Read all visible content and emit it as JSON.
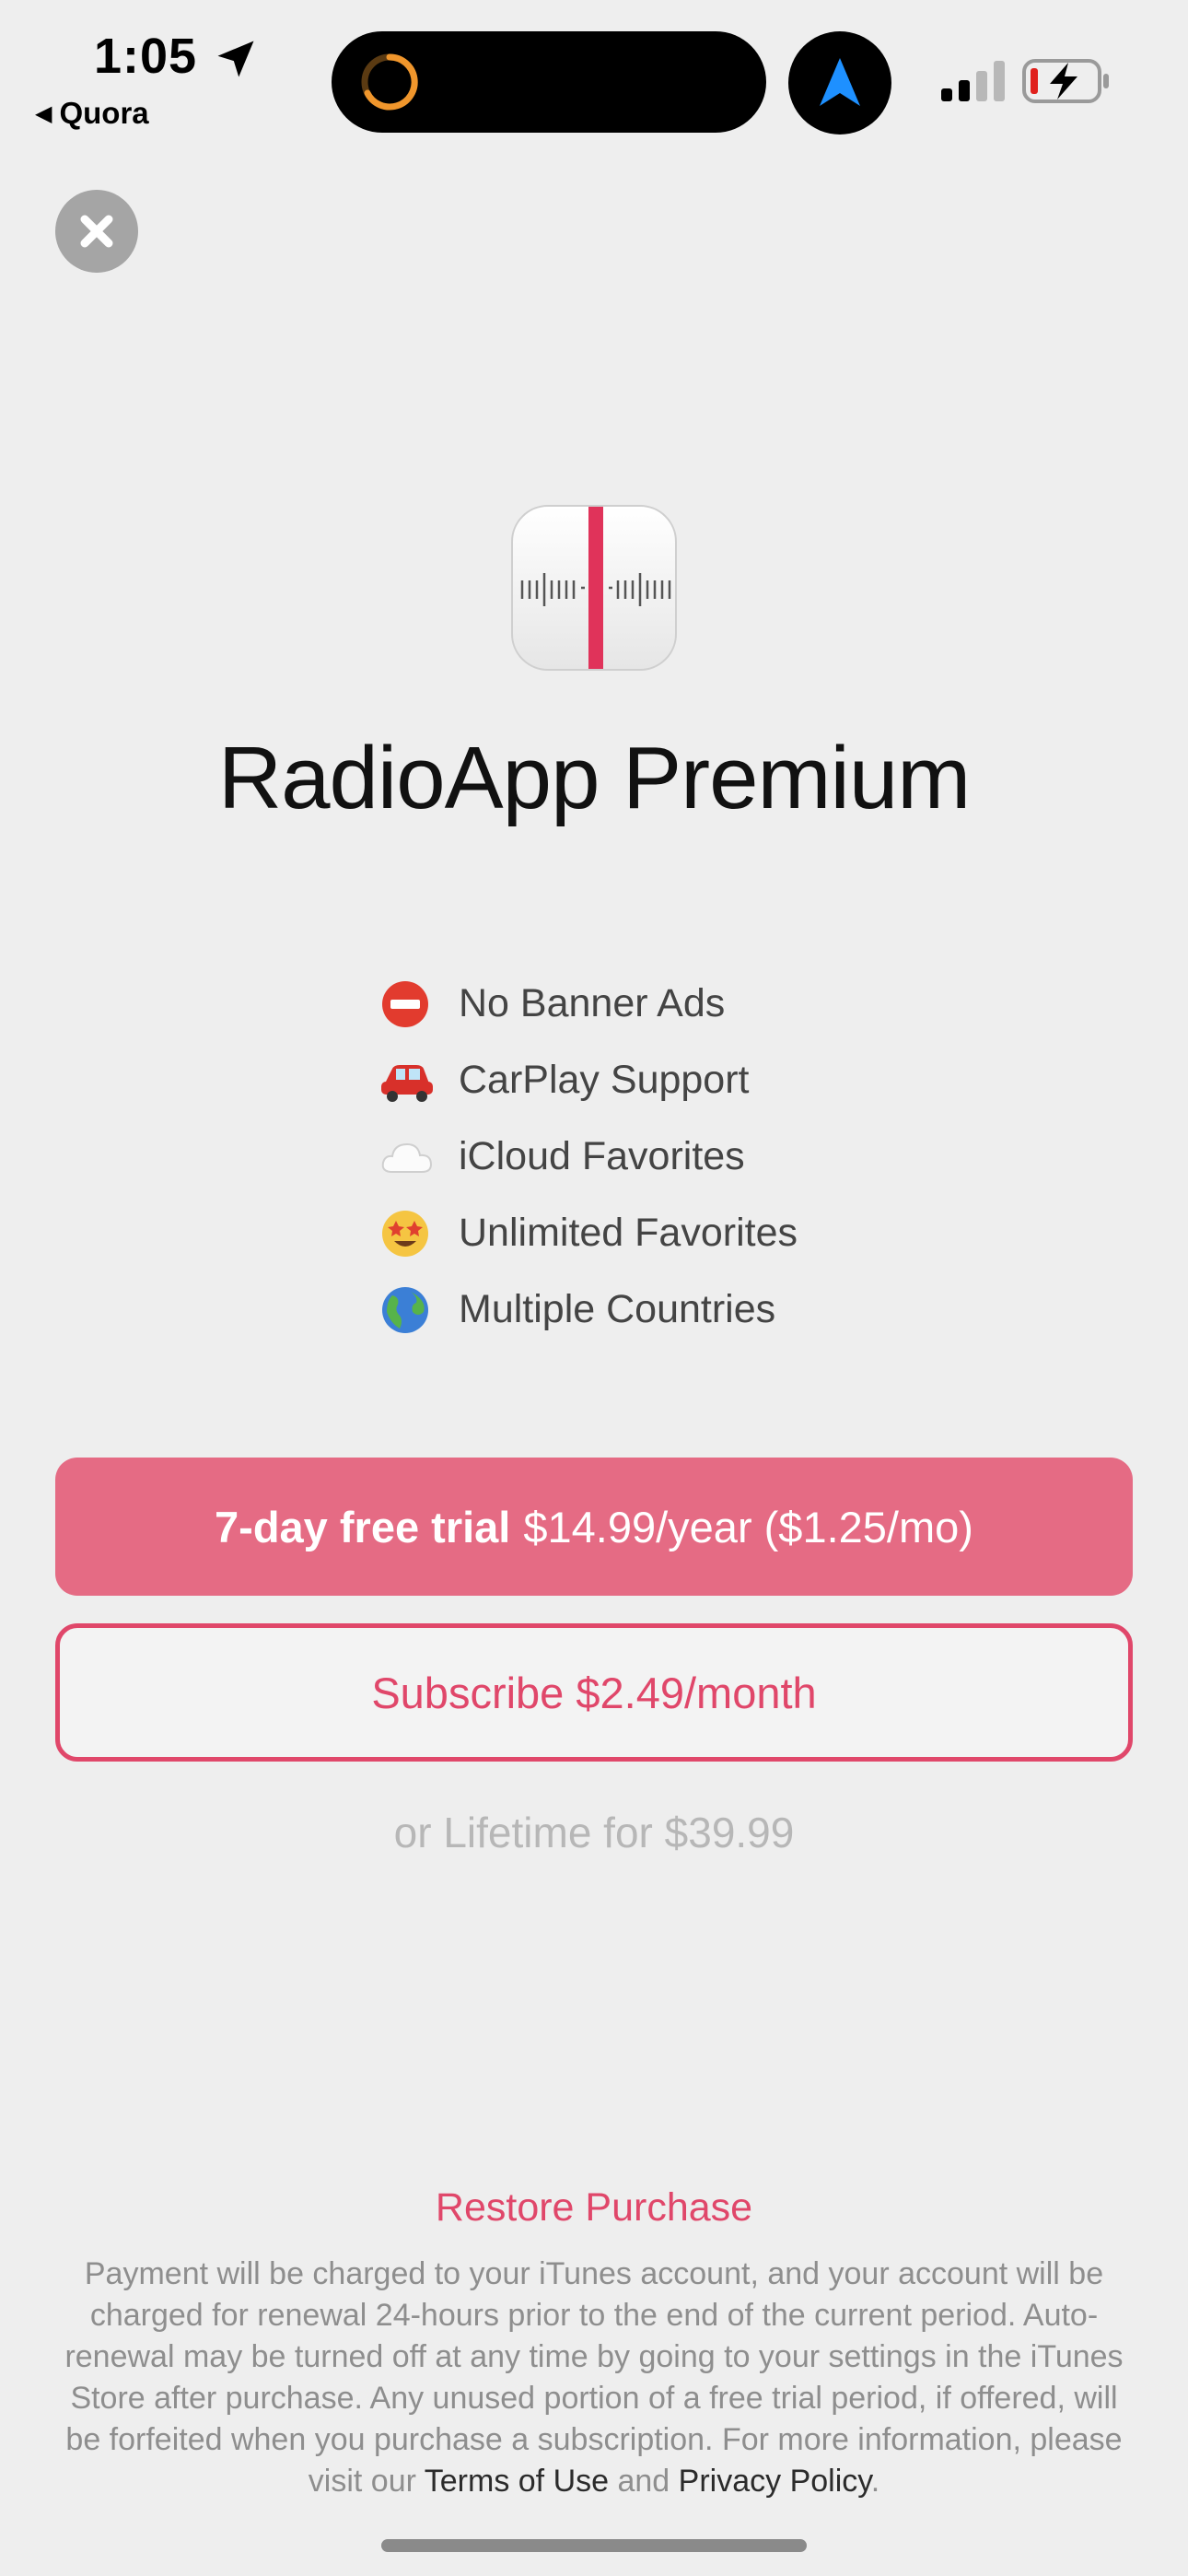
{
  "status_bar": {
    "time": "1:05",
    "back_app": "Quora"
  },
  "app": {
    "title": "RadioApp Premium",
    "accent_color": "#e0476a"
  },
  "features": [
    {
      "icon": "no-entry-icon",
      "label": "No Banner Ads"
    },
    {
      "icon": "car-icon",
      "label": "CarPlay Support"
    },
    {
      "icon": "cloud-icon",
      "label": "iCloud Favorites"
    },
    {
      "icon": "star-struck-icon",
      "label": "Unlimited Favorites"
    },
    {
      "icon": "globe-icon",
      "label": "Multiple Countries"
    }
  ],
  "plans": {
    "trial_bold": "7-day free trial",
    "trial_price": "$14.99/year ($1.25/mo)",
    "monthly": "Subscribe $2.49/month",
    "lifetime": "or Lifetime for $39.99"
  },
  "restore_label": "Restore Purchase",
  "legal": {
    "text": "Payment will be charged to your iTunes account, and your account will be charged for renewal 24-hours prior to the end of the current period. Auto-renewal may be turned off at any time by going to your settings in the iTunes Store after purchase. Any unused portion of a free trial period, if offered, will be forfeited when you purchase a subscription. For more information, please visit our",
    "terms_link": "Terms of Use",
    "and": "and",
    "privacy_link": "Privacy Policy",
    "end": "."
  }
}
